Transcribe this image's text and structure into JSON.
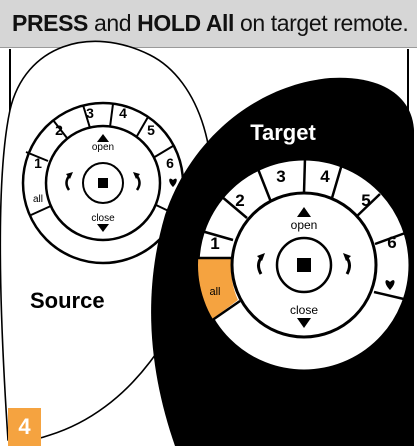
{
  "instruction": {
    "word_press": "PRESS",
    "word_and": " and ",
    "word_hold_all": "HOLD All",
    "word_rest": " on target remote."
  },
  "step_number": "4",
  "highlight_color": "#f5a340",
  "source_remote": {
    "label": "Source",
    "keys": {
      "n1": "1",
      "n2": "2",
      "n3": "3",
      "n4": "4",
      "n5": "5",
      "n6": "6",
      "all": "all",
      "open": "open",
      "close": "close"
    },
    "icons": [
      "stop-square",
      "rotate-left",
      "rotate-right",
      "heart",
      "up-arrow",
      "down-arrow"
    ]
  },
  "target_remote": {
    "label": "Target",
    "keys": {
      "n1": "1",
      "n2": "2",
      "n3": "3",
      "n4": "4",
      "n5": "5",
      "n6": "6",
      "all": "all",
      "open": "open",
      "close": "close"
    },
    "highlighted_key": "all",
    "icons": [
      "stop-square",
      "rotate-left",
      "rotate-right",
      "heart",
      "up-arrow",
      "down-arrow"
    ]
  }
}
